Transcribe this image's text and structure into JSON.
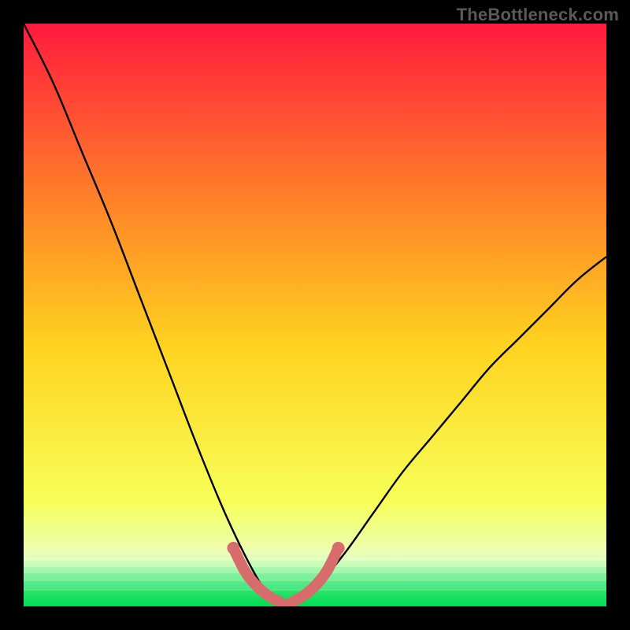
{
  "watermark": {
    "text": "TheBottleneck.com"
  },
  "colors": {
    "frame_bg": "#000000",
    "gradient_top": "#ff1a3d",
    "gradient_mid_top": "#ff7a2a",
    "gradient_mid": "#ffd21f",
    "gradient_low": "#f7ff58",
    "gradient_band": "#e8ffc2",
    "gradient_bottom": "#00dd55",
    "curve_main": "#000000",
    "curve_highlight": "#d86b6b"
  },
  "chart_data": {
    "type": "line",
    "title": "",
    "xlabel": "",
    "ylabel": "",
    "xlim": [
      0,
      100
    ],
    "ylim": [
      0,
      100
    ],
    "grid": false,
    "legend": false,
    "series": [
      {
        "name": "bottleneck-curve",
        "x": [
          0,
          5,
          10,
          15,
          20,
          25,
          30,
          35,
          40,
          43,
          45,
          47,
          50,
          55,
          60,
          65,
          70,
          75,
          80,
          85,
          90,
          95,
          100
        ],
        "values": [
          100,
          90,
          78,
          66,
          53,
          40,
          27,
          15,
          5,
          1,
          0,
          1,
          3,
          9,
          16,
          23,
          29,
          35,
          41,
          46,
          51,
          56,
          60
        ]
      }
    ],
    "highlight_segment": {
      "name": "valley-highlight",
      "x": [
        36,
        38,
        40,
        42,
        44,
        45,
        46,
        48,
        50,
        52,
        54
      ],
      "values": [
        10,
        6,
        3.5,
        1.8,
        0.7,
        0,
        0.7,
        1.8,
        3.5,
        6,
        10
      ]
    },
    "gradient_meaning": "vertical red-to-green scale (top = worse / bottleneck, bottom = optimal)"
  }
}
